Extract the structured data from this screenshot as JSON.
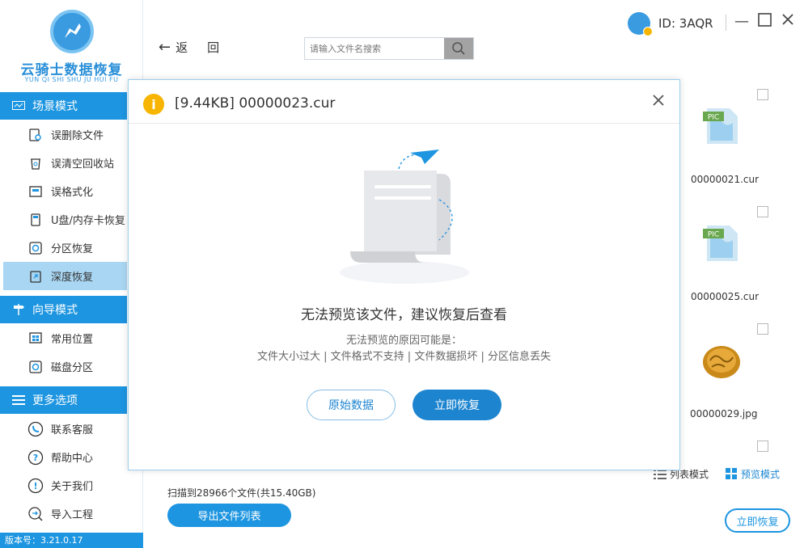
{
  "app": {
    "logo_title": "云骑士数据恢复",
    "logo_subtitle": "YUN QI SHI SHU JU HUI FU",
    "version_label": "版本号：3.21.0.17"
  },
  "sidebar": {
    "sections": [
      {
        "label": "场景模式",
        "items": [
          "误删除文件",
          "误清空回收站",
          "误格式化",
          "U盘/内存卡恢复",
          "分区恢复",
          "深度恢复"
        ]
      },
      {
        "label": "向导模式",
        "items": [
          "常用位置",
          "磁盘分区"
        ]
      },
      {
        "label": "更多选项",
        "items": [
          "联系客服",
          "帮助中心",
          "关于我们",
          "导入工程"
        ]
      }
    ],
    "active_item": "深度恢复"
  },
  "topbar": {
    "back_text_1": "返",
    "back_text_2": "回",
    "search_placeholder": "请输入文件名搜索",
    "user_id": "ID: 3AQR"
  },
  "files": [
    {
      "name": "00000021.cur",
      "type": "PIC"
    },
    {
      "name": "00000025.cur",
      "type": "PIC"
    },
    {
      "name": "00000029.jpg",
      "type": "jpg"
    }
  ],
  "view": {
    "list_mode": "列表模式",
    "preview_mode": "预览模式"
  },
  "footer": {
    "scan_info": "扫描到28966个文件(共15.40GB)",
    "export_button": "导出文件列表",
    "recover_button": "立即恢复"
  },
  "modal": {
    "title": "[9.44KB] 00000023.cur",
    "message_main": "无法预览该文件，建议恢复后查看",
    "message_sub1": "无法预览的原因可能是：",
    "message_sub2": "文件大小过大 | 文件格式不支持 | 文件数据损坏 | 分区信息丢失",
    "raw_button": "原始数据",
    "recover_button": "立即恢复"
  },
  "colors": {
    "accent": "#1d95e0",
    "active_bg": "#a9d6f2",
    "warning": "#f7b500"
  }
}
